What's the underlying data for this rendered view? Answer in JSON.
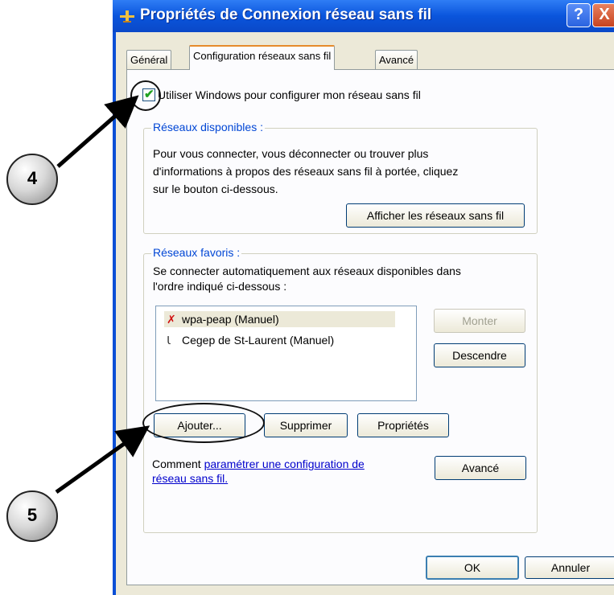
{
  "window": {
    "title": "Propriétés de Connexion réseau sans fil",
    "help_label": "?",
    "close_label": "X"
  },
  "tabs": [
    {
      "label": "Général"
    },
    {
      "label": "Configuration réseaux sans fil"
    },
    {
      "label": "Avancé"
    }
  ],
  "checkbox": {
    "label": "Utiliser Windows pour configurer mon réseau sans fil",
    "checked": true
  },
  "available": {
    "title": "Réseaux disponibles :",
    "line1": "Pour vous connecter, vous déconnecter ou trouver plus",
    "line2": "d'informations à propos des réseaux sans fil à portée, cliquez",
    "line3": "sur le bouton ci-dessous.",
    "button": "Afficher les réseaux sans fil"
  },
  "favorites": {
    "title": "Réseaux favoris :",
    "line1": "Se connecter automatiquement aux réseaux disponibles dans",
    "line2": "l'ordre indiqué ci-dessous :",
    "items": [
      {
        "label": "wpa-peap (Manuel)",
        "icon": "wireless-error-icon",
        "selected": true
      },
      {
        "label": "Cegep de St-Laurent (Manuel)",
        "icon": "wireless-antenna-icon",
        "selected": false
      }
    ],
    "up_button": "Monter",
    "down_button": "Descendre",
    "add_button": "Ajouter...",
    "remove_button": "Supprimer",
    "properties_button": "Propriétés"
  },
  "help": {
    "prefix": "Comment ",
    "link1": "paramétrer une configuration de",
    "link2": "réseau sans fil.",
    "advanced_button": "Avancé"
  },
  "footer": {
    "ok": "OK",
    "cancel": "Annuler"
  },
  "callouts": [
    {
      "label": "4"
    },
    {
      "label": "5"
    }
  ]
}
